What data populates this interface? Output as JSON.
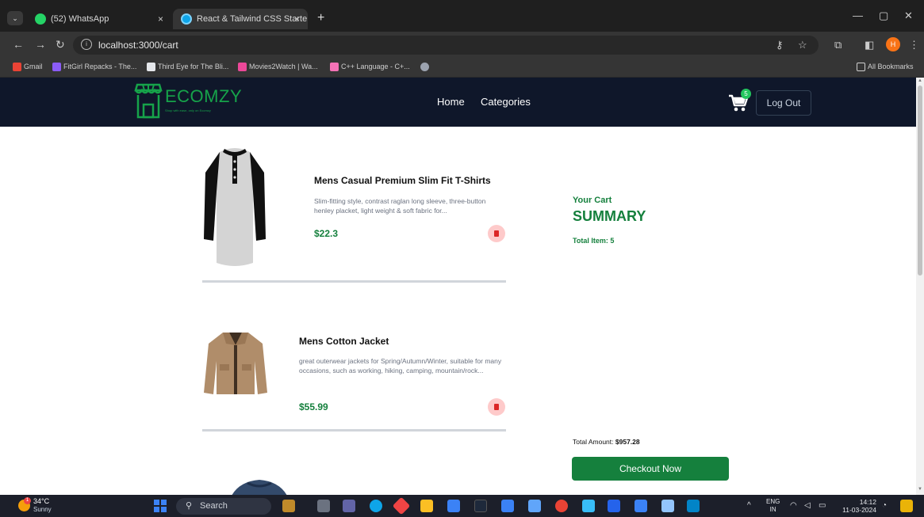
{
  "browser": {
    "menu_glyph": "⌄",
    "tabs": [
      {
        "title": "(52) WhatsApp",
        "close": "×"
      },
      {
        "title": "React & Tailwind CSS Starter Pa",
        "close": "×"
      }
    ],
    "new_tab": "+",
    "window_controls": {
      "minimize": "—",
      "maximize": "▢",
      "close": "✕"
    },
    "url": "localhost:3000/cart",
    "bookmarks": [
      {
        "label": "Gmail",
        "color": "#ea4335"
      },
      {
        "label": "FitGirl Repacks - The...",
        "color": "#8b5cf6"
      },
      {
        "label": "Third Eye for The Bli...",
        "color": "#e5e7eb"
      },
      {
        "label": "Movies2Watch | Wa...",
        "color": "#ec4899"
      },
      {
        "label": "C++ Language - C+...",
        "color": "#f472b6"
      },
      {
        "label": "",
        "color": "#9ca3af"
      }
    ],
    "all_bookmarks": "All Bookmarks",
    "profile_initial": "H"
  },
  "site": {
    "logo_text": "ECOMZY",
    "logo_tagline": "Shop with ease, only on Ecomzy",
    "nav": {
      "home": "Home",
      "categories": "Categories"
    },
    "cart_count": "5",
    "logout": "Log Out",
    "brand_color": "#15803d",
    "nav_bg": "#0f172a"
  },
  "cart": {
    "items": [
      {
        "title": "Mens Casual Premium Slim Fit T-Shirts",
        "description": "Slim-fitting style, contrast raglan long sleeve, three-button henley placket, light weight & soft fabric for...",
        "price": "$22.3"
      },
      {
        "title": "Mens Cotton Jacket",
        "description": "great outerwear jackets for Spring/Autumn/Winter, suitable for many occasions, such as working, hiking, camping, mountain/rock...",
        "price": "$55.99"
      }
    ],
    "summary": {
      "heading_small": "Your Cart",
      "heading_big": "SUMMARY",
      "total_items": "Total Item: 5",
      "total_label": "Total Amount:",
      "total_value": "$957.28",
      "checkout": "Checkout Now"
    }
  },
  "taskbar": {
    "temperature": "34°C",
    "condition": "Sunny",
    "weather_badge": "1",
    "search": "Search",
    "language": "ENG",
    "region": "IN",
    "time": "14:12",
    "date": "11-03-2024",
    "tray_caret": "^"
  }
}
